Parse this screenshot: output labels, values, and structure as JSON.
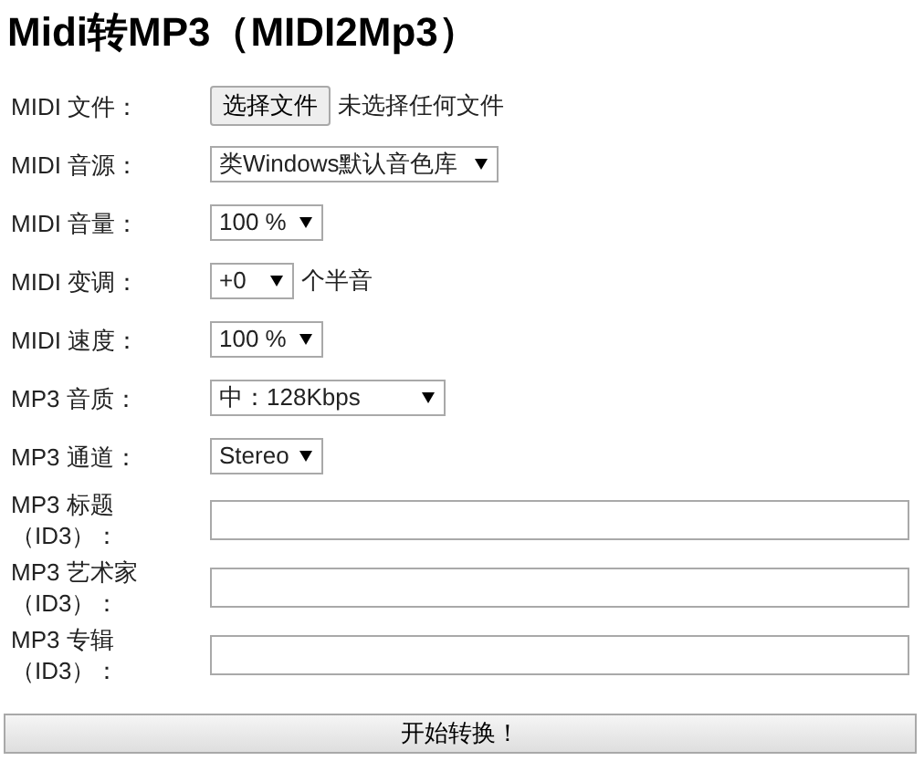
{
  "title": "Midi转MP3（MIDI2Mp3）",
  "fields": [
    {
      "kind": "file",
      "label": "MIDI 文件：",
      "button": "选择文件",
      "status": "未选择任何文件"
    },
    {
      "kind": "select",
      "label": "MIDI 音源：",
      "value": "类Windows默认音色库"
    },
    {
      "kind": "select",
      "label": "MIDI 音量：",
      "value": "100 %"
    },
    {
      "kind": "select",
      "label": "MIDI 变调：",
      "value": "+0",
      "suffix": "个半音"
    },
    {
      "kind": "select",
      "label": "MIDI 速度：",
      "value": "100 %"
    },
    {
      "kind": "select",
      "label": "MP3 音质：",
      "value": "中：128Kbps"
    },
    {
      "kind": "select",
      "label": "MP3 通道：",
      "value": "Stereo"
    },
    {
      "kind": "text",
      "label": "MP3 标题（ID3）："
    },
    {
      "kind": "text",
      "label": "MP3 艺术家（ID3）："
    },
    {
      "kind": "text",
      "label": "MP3 专辑（ID3）："
    }
  ],
  "submit": "开始转换！"
}
